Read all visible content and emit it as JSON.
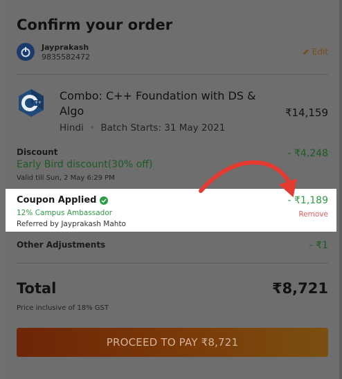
{
  "header": {
    "title": "Confirm your order"
  },
  "user": {
    "name": "Jayprakash",
    "phone": "9835582472",
    "edit_label": "Edit"
  },
  "course": {
    "title": "Combo: C++ Foundation with DS & Algo",
    "language": "Hindi",
    "separator": "•",
    "batch": "Batch Starts: 31 May 2021",
    "price": "₹14,159"
  },
  "discount": {
    "label": "Discount",
    "name": "Early Bird discount(30% off)",
    "valid": "Valid till Sun, 2 May 6:29 PM",
    "value": "- ₹4,248"
  },
  "coupon": {
    "label": "Coupon Applied",
    "name": "12% Campus Ambassador",
    "referred": "Referred by Jayprakash Mahto",
    "value": "- ₹1,189",
    "remove_label": "Remove"
  },
  "adjustments": {
    "label": "Other Adjustments",
    "value": "- ₹1"
  },
  "total": {
    "label": "Total",
    "value": "₹8,721",
    "gst_note": "Price inclusive of 18% GST"
  },
  "pay_button": {
    "label": "PROCEED TO PAY ₹8,721"
  },
  "colors": {
    "accent_green": "#2d9a44",
    "remove_red": "#e06060",
    "arrow_red": "#e53a2f"
  }
}
